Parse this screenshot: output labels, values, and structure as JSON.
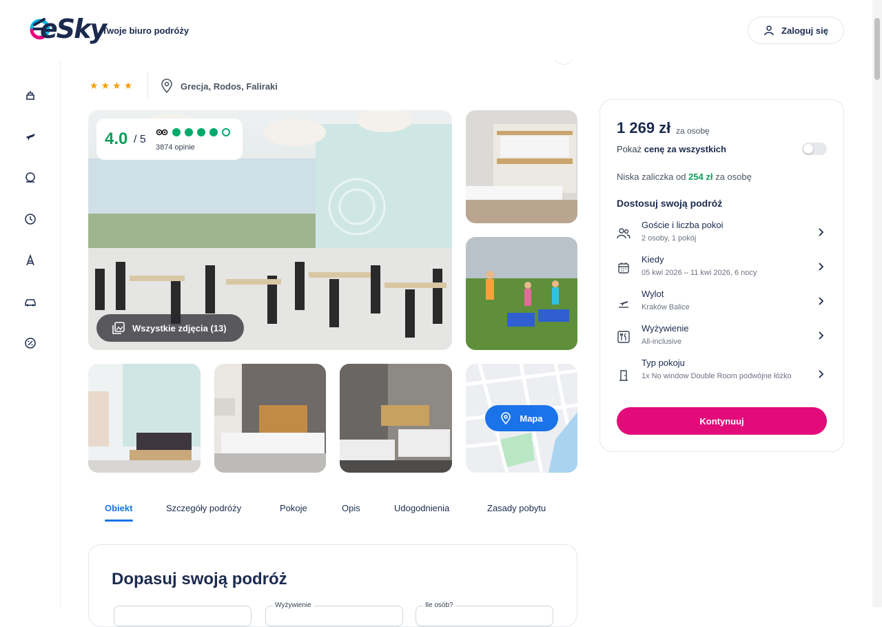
{
  "header": {
    "logo": "eSky",
    "tagline": "Twoje biuro podróży",
    "login_label": "Zaloguj się"
  },
  "sidebar": {
    "items": [
      {
        "icon": "hotel-icon"
      },
      {
        "icon": "flight-icon"
      },
      {
        "icon": "beach-icon"
      },
      {
        "icon": "clock-icon"
      },
      {
        "icon": "attraction-icon"
      },
      {
        "icon": "car-icon"
      },
      {
        "icon": "discount-icon"
      }
    ]
  },
  "hotel": {
    "stars": 4,
    "location": "Grecja, Rodos, Faliraki"
  },
  "rating": {
    "score": "4.0",
    "max": "/ 5",
    "reviews": "3874 opinie",
    "filled_dots": 4,
    "total_dots": 5
  },
  "gallery": {
    "all_photos_label": "Wszystkie zdjęcia (13)",
    "map_label": "Mapa"
  },
  "tabs": [
    {
      "label": "Obiekt",
      "active": true
    },
    {
      "label": "Szczegóły podróży",
      "active": false
    },
    {
      "label": "Pokoje",
      "active": false
    },
    {
      "label": "Opis",
      "active": false
    },
    {
      "label": "Udogodnienia",
      "active": false
    },
    {
      "label": "Zasady pobytu",
      "active": false
    }
  ],
  "fit": {
    "title": "Dopasuj swoją podróż",
    "field_meal_label": "Wyżywienie",
    "field_people_label": "Ile osób?"
  },
  "booking": {
    "price": "1 269 zł",
    "price_per": "za osobę",
    "show_total_prefix": "Pokaż ",
    "show_total_bold": "cenę za wszystkich",
    "deposit_prefix": "Niska zaliczka od ",
    "deposit_amount": "254 zł",
    "deposit_suffix": " za osobę",
    "customize_title": "Dostosuj swoją podróż",
    "options": [
      {
        "title": "Goście i liczba pokoi",
        "value": "2 osoby, 1 pokój",
        "icon": "guests-icon"
      },
      {
        "title": "Kiedy",
        "value": "05 kwi 2026 – 11 kwi 2026, 6 nocy",
        "icon": "calendar-icon"
      },
      {
        "title": "Wylot",
        "value": "Kraków Balice",
        "icon": "departure-icon"
      },
      {
        "title": "Wyżywienie",
        "value": "All-inclusive",
        "icon": "meal-icon"
      },
      {
        "title": "Typ pokoju",
        "value": "1x No window Double Room podwójne łóżko",
        "icon": "door-icon"
      }
    ],
    "continue_label": "Kontynuuj"
  },
  "colors": {
    "brand_pink": "#e30b7a",
    "primary_blue": "#1a73e8",
    "rating_green": "#00aa6c",
    "star_orange": "#f59e0b"
  }
}
